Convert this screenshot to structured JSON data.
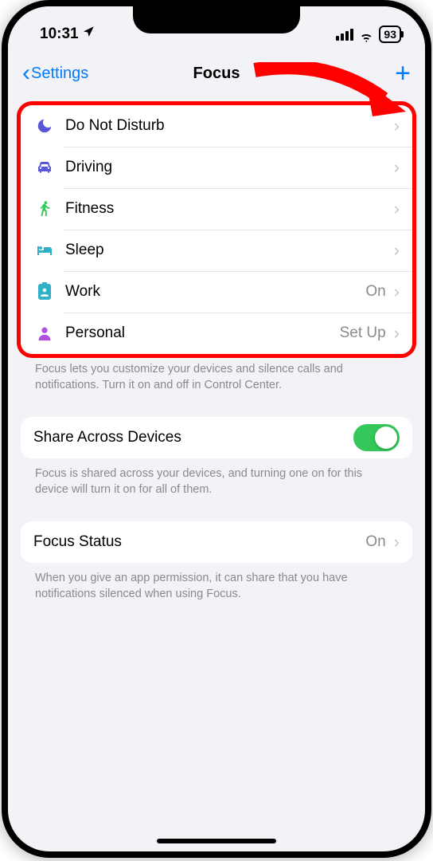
{
  "status": {
    "time": "10:31",
    "battery": "93"
  },
  "nav": {
    "back_label": "Settings",
    "title": "Focus"
  },
  "focus_modes": [
    {
      "icon": "moon-icon",
      "label": "Do Not Disturb",
      "detail": ""
    },
    {
      "icon": "car-icon",
      "label": "Driving",
      "detail": ""
    },
    {
      "icon": "runner-icon",
      "label": "Fitness",
      "detail": ""
    },
    {
      "icon": "bed-icon",
      "label": "Sleep",
      "detail": ""
    },
    {
      "icon": "badge-icon",
      "label": "Work",
      "detail": "On"
    },
    {
      "icon": "person-icon",
      "label": "Personal",
      "detail": "Set Up"
    }
  ],
  "footers": {
    "modes": "Focus lets you customize your devices and silence calls and notifications. Turn it on and off in Control Center.",
    "share": "Focus is shared across your devices, and turning one on for this device will turn it on for all of them.",
    "status": "When you give an app permission, it can share that you have notifications silenced when using Focus."
  },
  "share_row": {
    "label": "Share Across Devices",
    "on": true
  },
  "status_row": {
    "label": "Focus Status",
    "detail": "On"
  },
  "icons": {
    "moon-icon": "svg-moon",
    "car-icon": "svg-car",
    "runner-icon": "svg-run",
    "bed-icon": "svg-bed",
    "badge-icon": "svg-badge",
    "person-icon": "svg-person"
  }
}
